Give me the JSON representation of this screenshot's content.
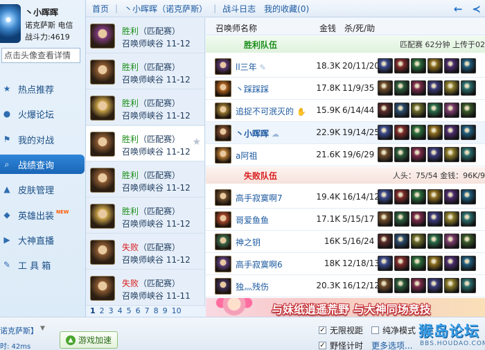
{
  "profile": {
    "name": "丶小晖晖",
    "server": "诺克萨斯 电信",
    "power": "战斗力:4619",
    "search_placeholder": "点击头像查看详情"
  },
  "nav": [
    {
      "label": "热点推荐",
      "icon": "star-icon",
      "glyph": "★"
    },
    {
      "label": "火爆论坛",
      "icon": "chat-icon",
      "glyph": "●"
    },
    {
      "label": "我的对战",
      "icon": "battle-icon",
      "glyph": "⚑"
    },
    {
      "label": "战绩查询",
      "icon": "search-icon",
      "glyph": "⌕"
    },
    {
      "label": "皮肤管理",
      "icon": "hat-icon",
      "glyph": "▲"
    },
    {
      "label": "英雄出装",
      "icon": "hero-icon",
      "glyph": "◆",
      "badge": "NEW"
    },
    {
      "label": "大神直播",
      "icon": "live-icon",
      "glyph": "▶"
    },
    {
      "label": "工 具 箱",
      "icon": "tool-icon",
      "glyph": "✎"
    }
  ],
  "topbar": {
    "home": "首页",
    "sep": "|",
    "player_crumb": "丶小晖晖（诺克萨斯）",
    "log": "战斗日志",
    "favorites": "我的收藏(0)"
  },
  "matches": [
    {
      "result": "胜利",
      "mode": "（匹配赛）",
      "map": "召唤师峡谷",
      "date": "11-12",
      "win": true,
      "color": "#7d3a7e"
    },
    {
      "result": "胜利",
      "mode": "（匹配赛）",
      "map": "召唤师峡谷",
      "date": "11-12",
      "win": true,
      "color": "#8a5a32"
    },
    {
      "result": "胜利",
      "mode": "（匹配赛）",
      "map": "召唤师峡谷",
      "date": "11-12",
      "win": true,
      "color": "#c9a44a"
    },
    {
      "result": "胜利",
      "mode": "（匹配赛）",
      "map": "召唤师峡谷",
      "date": "11-12",
      "win": true,
      "color": "#8a5a32"
    },
    {
      "result": "胜利",
      "mode": "（匹配赛）",
      "map": "召唤师峡谷",
      "date": "11-12",
      "win": true,
      "color": "#8a5a32"
    },
    {
      "result": "胜利",
      "mode": "（匹配赛）",
      "map": "召唤师峡谷",
      "date": "11-12",
      "win": true,
      "color": "#c9a44a"
    },
    {
      "result": "失败",
      "mode": "（匹配赛）",
      "map": "召唤师峡谷",
      "date": "11-12",
      "win": false,
      "color": "#8a5a32"
    },
    {
      "result": "失败",
      "mode": "（匹配赛）",
      "map": "召唤师峡谷",
      "date": "11-11",
      "win": false,
      "color": "#8a5a32"
    }
  ],
  "pager": [
    "1",
    "2",
    "3",
    "4",
    "5",
    "6",
    "7",
    "8",
    "9",
    "10"
  ],
  "table_header": {
    "name": "召唤师名称",
    "gold": "金钱",
    "kda": "杀/死/助"
  },
  "win_team": {
    "label": "胜利队伍",
    "info": "匹配赛  62分钟  上传于02"
  },
  "lose_team": {
    "label": "失败队伍",
    "info": "人头：75/54  金钱：96K/9"
  },
  "win_players": [
    {
      "name": "ll三年",
      "tag": "✎",
      "gold": "18.3K",
      "kda": "20/11/20",
      "champ": "#5b3a72"
    },
    {
      "name": "丶踩踩踩",
      "tag": "",
      "gold": "17.8K",
      "kda": "11/9/35",
      "champ": "#b0631f"
    },
    {
      "name": "追捉不可泯灭的",
      "tag": "✋",
      "gold": "15.9K",
      "kda": "6/14/44",
      "champ": "#9a7a32"
    },
    {
      "name": "丶小晖晖",
      "tag": "☁",
      "gold": "22.9K",
      "kda": "19/14/25",
      "champ": "#7a4a2e",
      "me": true
    },
    {
      "name": "a阿祖",
      "tag": "",
      "gold": "21.6K",
      "kda": "19/6/29",
      "champ": "#b67a35"
    }
  ],
  "lose_players": [
    {
      "name": "高手寂寞啊7",
      "gold": "19.4K",
      "kda": "16/14/12",
      "champ": "#6d4d2c"
    },
    {
      "name": "哥爱鱼鱼",
      "gold": "17.1K",
      "kda": "5/15/17",
      "champ": "#a8472a"
    },
    {
      "name": "神之钥",
      "gold": "16K",
      "kda": "5/16/24",
      "champ": "#3f6b4a"
    },
    {
      "name": "高手寂寞啊6",
      "gold": "18K",
      "kda": "12/18/13",
      "champ": "#5c3f7a"
    },
    {
      "name": "独灬残伤",
      "gold": "20.3K",
      "kda": "16/12/12",
      "champ": "#3d3054"
    }
  ],
  "banner": {
    "text": "与妹纸逍遥荒野  与大神同场竞技"
  },
  "bottom": {
    "server": "诺克萨斯】",
    "ping": "时: 42ms",
    "boost": "游戏加速",
    "opt1": "无限视距",
    "opt2": "纯净模式",
    "opt3": "野怪计时",
    "more": "更多选项...",
    "watermark": "猴岛论坛",
    "watermark_url": "BBS.HOUDAO.COM"
  },
  "colors": {
    "accent": "#1a66b8",
    "win": "#1d8f1d",
    "lose": "#d81e1e",
    "link": "#1d5aa0"
  }
}
